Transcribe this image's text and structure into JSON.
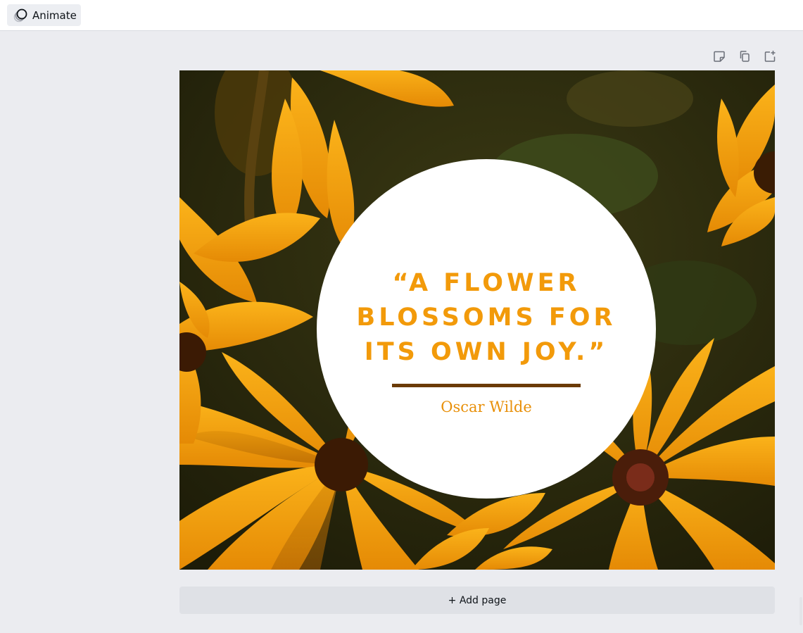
{
  "toolbar": {
    "animate_label": "Animate",
    "animate_icon": "animate-icon"
  },
  "page_tools": [
    {
      "icon": "note-icon"
    },
    {
      "icon": "duplicate-page-icon"
    },
    {
      "icon": "add-page-icon"
    }
  ],
  "design": {
    "quote_lines": [
      "“A FLOWER",
      "BLOSSOMS FOR",
      "ITS OWN JOY.”"
    ],
    "author": "Oscar Wilde",
    "colors": {
      "quote": "#f29a0a",
      "rule": "#6b3b05",
      "author": "#e8900a",
      "petal": "#f5a70f"
    }
  },
  "footer": {
    "add_page_label": "+ Add page"
  }
}
